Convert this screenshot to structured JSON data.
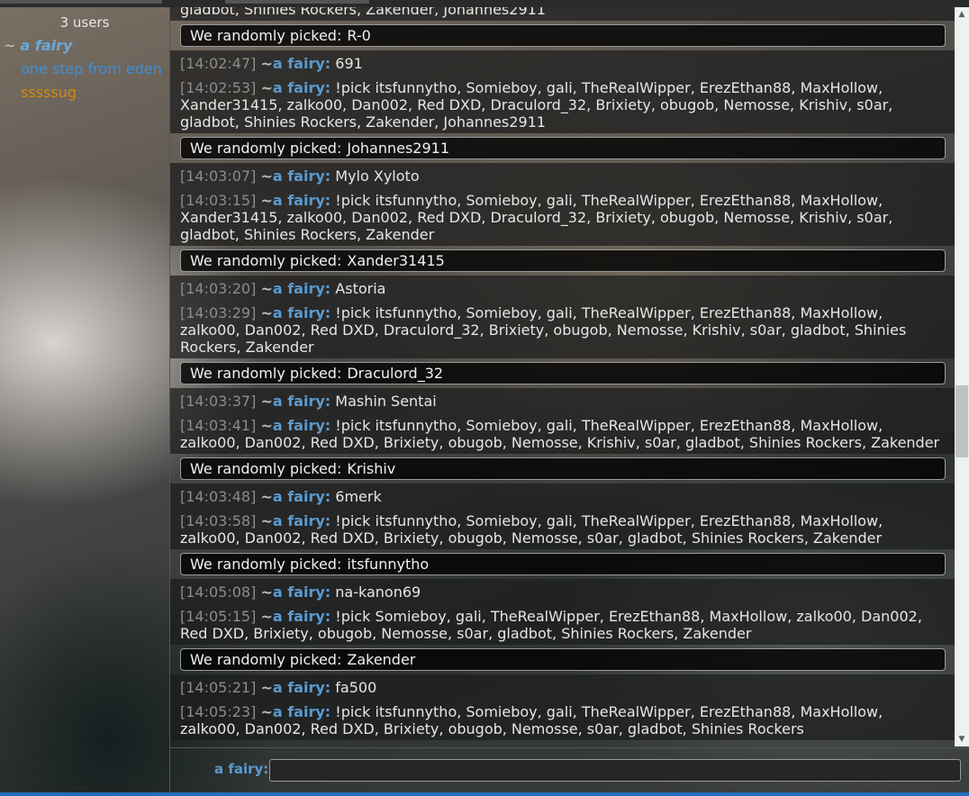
{
  "userlist": {
    "count": "3 users",
    "users": [
      {
        "prefix": "~",
        "name": "a fairy"
      },
      {
        "prefix": "",
        "name": "one step from eden"
      },
      {
        "prefix": "",
        "name": "sssssug"
      }
    ]
  },
  "chat": {
    "top_partial": "gladbot, Shinies Rockers, Zakender, Johannes2911",
    "picked_label": "We randomly picked:",
    "sender": "a fairy",
    "sender_prefix": "~",
    "items": [
      {
        "type": "pick",
        "value": "R-0"
      },
      {
        "type": "msg",
        "time": "[14:02:47]",
        "text": "691"
      },
      {
        "type": "msg",
        "time": "[14:02:53]",
        "text": "!pick itsfunnytho, Somieboy, gali, TheRealWipper, ErezEthan88, MaxHollow, Xander31415, zalko00, Dan002, Red DXD, Draculord_32, Brixiety, obugob, Nemosse, Krishiv, s0ar, gladbot, Shinies Rockers, Zakender, Johannes2911"
      },
      {
        "type": "pick",
        "value": "Johannes2911"
      },
      {
        "type": "msg",
        "time": "[14:03:07]",
        "text": "Mylo Xyloto"
      },
      {
        "type": "msg",
        "time": "[14:03:15]",
        "text": "!pick itsfunnytho, Somieboy, gali, TheRealWipper, ErezEthan88, MaxHollow, Xander31415, zalko00, Dan002, Red DXD, Draculord_32, Brixiety, obugob, Nemosse, Krishiv, s0ar, gladbot, Shinies Rockers, Zakender"
      },
      {
        "type": "pick",
        "value": "Xander31415"
      },
      {
        "type": "msg",
        "time": "[14:03:20]",
        "text": "Astoria"
      },
      {
        "type": "msg",
        "time": "[14:03:29]",
        "text": "!pick itsfunnytho, Somieboy, gali, TheRealWipper, ErezEthan88, MaxHollow, zalko00, Dan002, Red DXD, Draculord_32, Brixiety, obugob, Nemosse, Krishiv, s0ar, gladbot, Shinies Rockers, Zakender"
      },
      {
        "type": "pick",
        "value": "Draculord_32"
      },
      {
        "type": "msg",
        "time": "[14:03:37]",
        "text": "Mashin Sentai"
      },
      {
        "type": "msg",
        "time": "[14:03:41]",
        "text": "!pick itsfunnytho, Somieboy, gali, TheRealWipper, ErezEthan88, MaxHollow, zalko00, Dan002, Red DXD, Brixiety, obugob, Nemosse, Krishiv, s0ar, gladbot, Shinies Rockers, Zakender"
      },
      {
        "type": "pick",
        "value": "Krishiv"
      },
      {
        "type": "msg",
        "time": "[14:03:48]",
        "text": "6merk"
      },
      {
        "type": "msg",
        "time": "[14:03:58]",
        "text": "!pick itsfunnytho, Somieboy, gali, TheRealWipper, ErezEthan88, MaxHollow, zalko00, Dan002, Red DXD, Brixiety, obugob, Nemosse, s0ar, gladbot, Shinies Rockers, Zakender"
      },
      {
        "type": "pick",
        "value": "itsfunnytho"
      },
      {
        "type": "msg",
        "time": "[14:05:08]",
        "text": "na-kanon69"
      },
      {
        "type": "msg",
        "time": "[14:05:15]",
        "text": "!pick Somieboy, gali, TheRealWipper, ErezEthan88, MaxHollow, zalko00, Dan002, Red DXD, Brixiety, obugob, Nemosse, s0ar, gladbot, Shinies Rockers, Zakender"
      },
      {
        "type": "pick",
        "value": "Zakender"
      },
      {
        "type": "msg",
        "time": "[14:05:21]",
        "text": "fa500"
      },
      {
        "type": "msg",
        "time": "[14:05:23]",
        "text": "!pick itsfunnytho, Somieboy, gali, TheRealWipper, ErezEthan88, MaxHollow, zalko00, Dan002, Red DXD, Brixiety, obugob, Nemosse, s0ar, gladbot, Shinies Rockers"
      }
    ]
  },
  "scrollbar": {
    "up_icon": "▲",
    "down_icon": "▼",
    "position_fraction": 0.57
  },
  "input": {
    "label": "a fairy:",
    "value": ""
  }
}
